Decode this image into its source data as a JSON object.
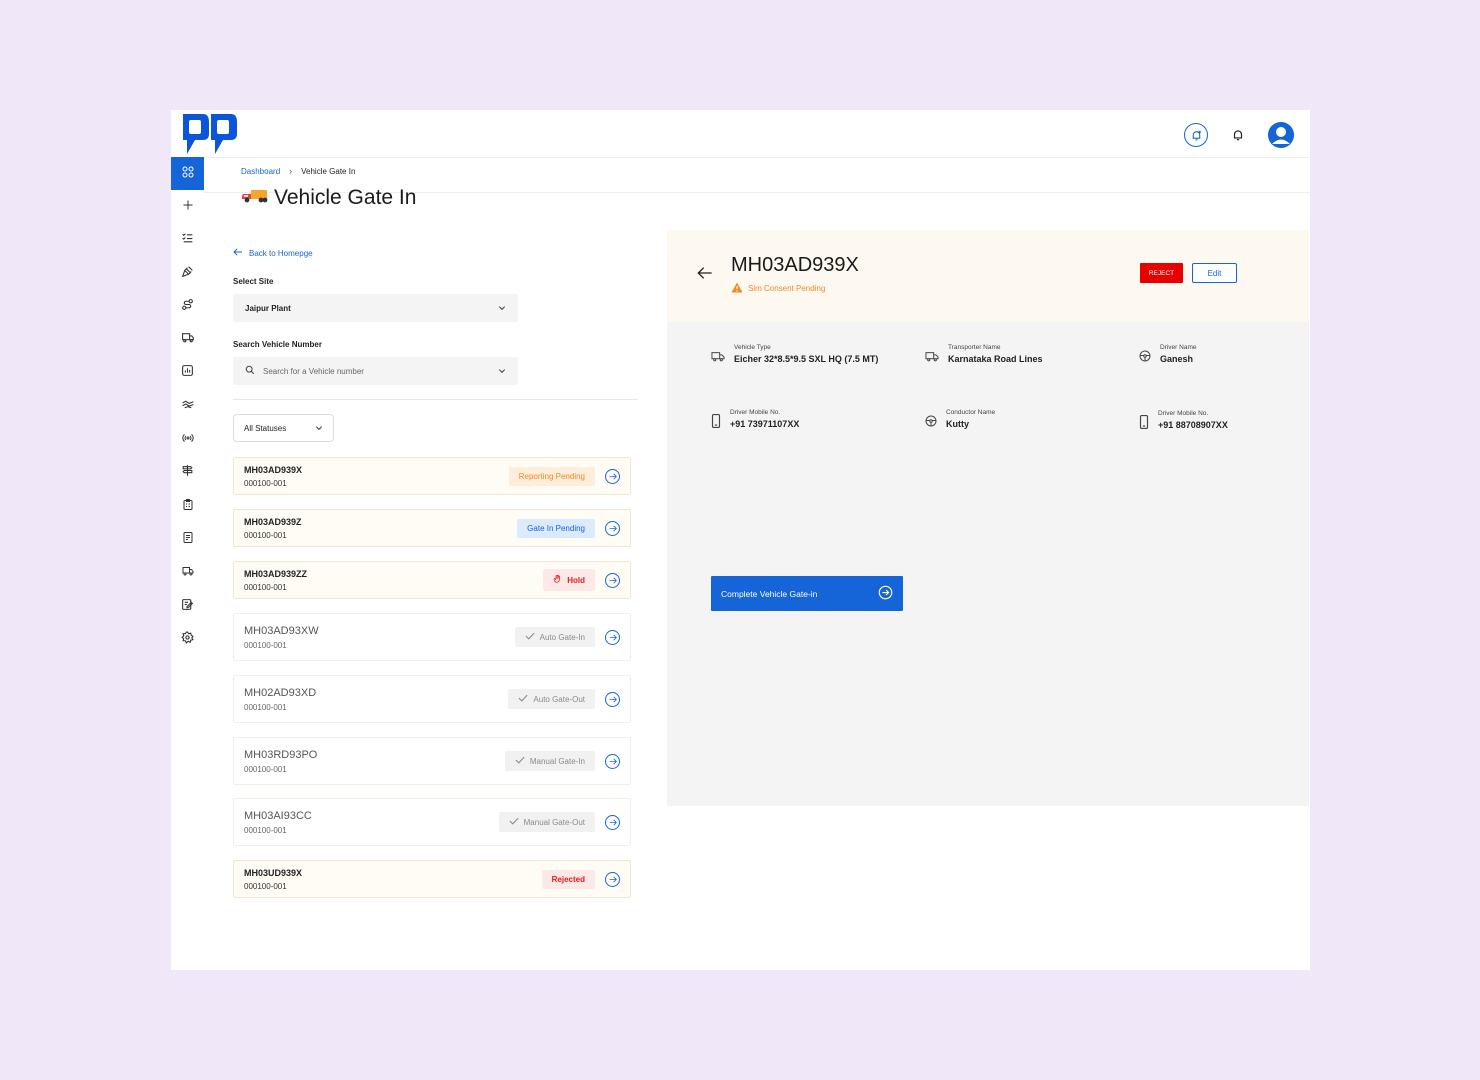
{
  "header": {
    "icons": [
      "bell-plus-icon",
      "bell-icon",
      "user-avatar-icon"
    ]
  },
  "sidebar": {
    "items": [
      {
        "icon": "grid-icon",
        "active": true
      },
      {
        "icon": "plus-icon"
      },
      {
        "icon": "checklist-icon"
      },
      {
        "icon": "gavel-icon"
      },
      {
        "icon": "route-icon"
      },
      {
        "icon": "truck-settings-icon"
      },
      {
        "icon": "chart-icon"
      },
      {
        "icon": "handshake-icon"
      },
      {
        "icon": "broadcast-icon"
      },
      {
        "icon": "signpost-icon"
      },
      {
        "icon": "clipboard-icon"
      },
      {
        "icon": "receipt-icon"
      },
      {
        "icon": "truck-icon"
      },
      {
        "icon": "edit-note-icon"
      },
      {
        "icon": "gear-icon"
      }
    ]
  },
  "breadcrumb": {
    "home": "Dashboard",
    "current": "Vehicle Gate In"
  },
  "page": {
    "title": "Vehicle Gate In"
  },
  "left": {
    "back_label": "Back to Homepge",
    "site_label": "Select Site",
    "site_value": "Jaipur Plant",
    "search_label": "Search Vehicle Number",
    "search_placeholder": "Search for a Vehicle number",
    "status_filter": "All Statuses"
  },
  "vehicles": [
    {
      "number": "MH03AD939X",
      "code": "000100-001",
      "status": "Reporting Pending"
    },
    {
      "number": "MH03AD939Z",
      "code": "000100-001",
      "status": "Gate In Pending"
    },
    {
      "number": "MH03AD939ZZ",
      "code": "000100-001",
      "status": "Hold"
    },
    {
      "number": "MH03AD93XW",
      "code": "000100-001",
      "status": "Auto Gate-In"
    },
    {
      "number": "MH02AD93XD",
      "code": "000100-001",
      "status": "Auto Gate-Out"
    },
    {
      "number": "MH03RD93PO",
      "code": "000100-001",
      "status": "Manual Gate-In"
    },
    {
      "number": "MH03AI93CC",
      "code": "000100-001",
      "status": "Manual Gate-Out"
    },
    {
      "number": "MH03UD939X",
      "code": "000100-001",
      "status": "Rejected"
    }
  ],
  "detail": {
    "vehicle_number": "MH03AD939X",
    "sim_status": "Sim Consent Pending",
    "reject_label": "REJECT",
    "edit_label": "Edit",
    "fields": [
      {
        "label": "Vehicle Type",
        "value": "Eicher 32*8.5*9.5 SXL HQ (7.5 MT)",
        "icon": "truck-icon"
      },
      {
        "label": "Transporter Name",
        "value": "Karnataka Road Lines",
        "icon": "truck-icon"
      },
      {
        "label": "Driver Name",
        "value": "Ganesh",
        "icon": "steering-wheel-icon"
      },
      {
        "label": "Driver Mobile No.",
        "value": "+91 73971107XX",
        "icon": "mobile-icon"
      },
      {
        "label": "Conductor Name",
        "value": "Kutty",
        "icon": "steering-wheel-icon"
      },
      {
        "label": "Driver Mobile No.",
        "value": "+91 88708907XX",
        "icon": "mobile-icon"
      }
    ],
    "complete_label": "Complete Vehicle Gate-in"
  },
  "colors": {
    "primary": "#1565d8",
    "reject": "#e60000",
    "warning": "#ef8a24",
    "background": "#f0e7f8"
  }
}
